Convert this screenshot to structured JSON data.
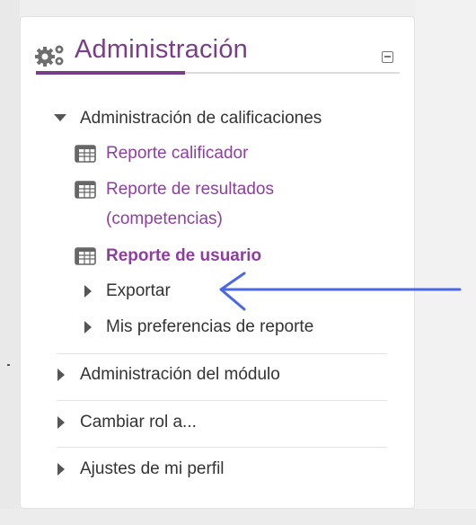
{
  "block": {
    "title": "Administración",
    "gear_icon": "gears-icon",
    "collapse_icon": "collapse-minus-icon"
  },
  "menu": {
    "grades_admin": "Administración de calificaciones",
    "grader_report": "Reporte calificador",
    "outcomes_report_line1": "Reporte de resultados",
    "outcomes_report_line2": "(competencias)",
    "user_report": "Reporte de usuario",
    "export": "Exportar",
    "report_prefs": "Mis preferencias de reporte",
    "module_admin": "Administración del módulo",
    "switch_role": "Cambiar rol a...",
    "profile_settings": "Ajustes de mi perfil"
  },
  "colors": {
    "accent": "#7a3d8a",
    "link": "#8e3ea3",
    "arrow": "#4a67e8"
  }
}
